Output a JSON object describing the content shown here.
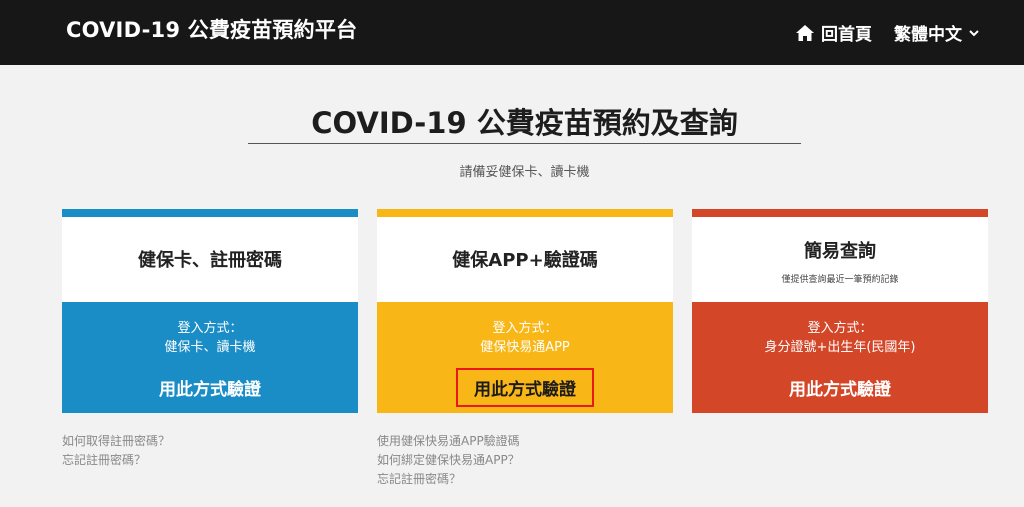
{
  "header": {
    "brand": "COVID-19 公費疫苗預約平台",
    "home_label": "回首頁",
    "language_label": "繁體中文"
  },
  "main": {
    "title": "COVID-19 公費疫苗預約及查詢",
    "subtitle": "請備妥健保卡、讀卡機"
  },
  "cards": [
    {
      "title": "健保卡、註冊密碼",
      "note": "",
      "login_label": "登入方式：",
      "login_value": "健保卡、讀卡機",
      "button_label": "用此方式驗證",
      "links": [
        "如何取得註冊密碼？",
        "忘記註冊密碼？"
      ]
    },
    {
      "title": "健保APP+驗證碼",
      "note": "",
      "login_label": "登入方式：",
      "login_value": "健保快易通APP",
      "button_label": "用此方式驗證",
      "links": [
        "使用健保快易通APP驗證碼",
        "如何綁定健保快易通APP？",
        "忘記註冊密碼？"
      ]
    },
    {
      "title": "簡易查詢",
      "note": "僅提供查詢最近一筆預約記錄",
      "login_label": "登入方式：",
      "login_value": "身分證號+出生年(民國年)",
      "button_label": "用此方式驗證",
      "links": []
    }
  ],
  "colors": {
    "topbar": "#171717",
    "background": "#f2f2f2",
    "card_blue": "#1a8dc7",
    "card_yellow": "#f9b617",
    "card_red": "#d44628",
    "highlight_border": "#e8181d"
  },
  "icons": {
    "home": "home-icon",
    "language_toggle": "chevron-down-icon"
  }
}
